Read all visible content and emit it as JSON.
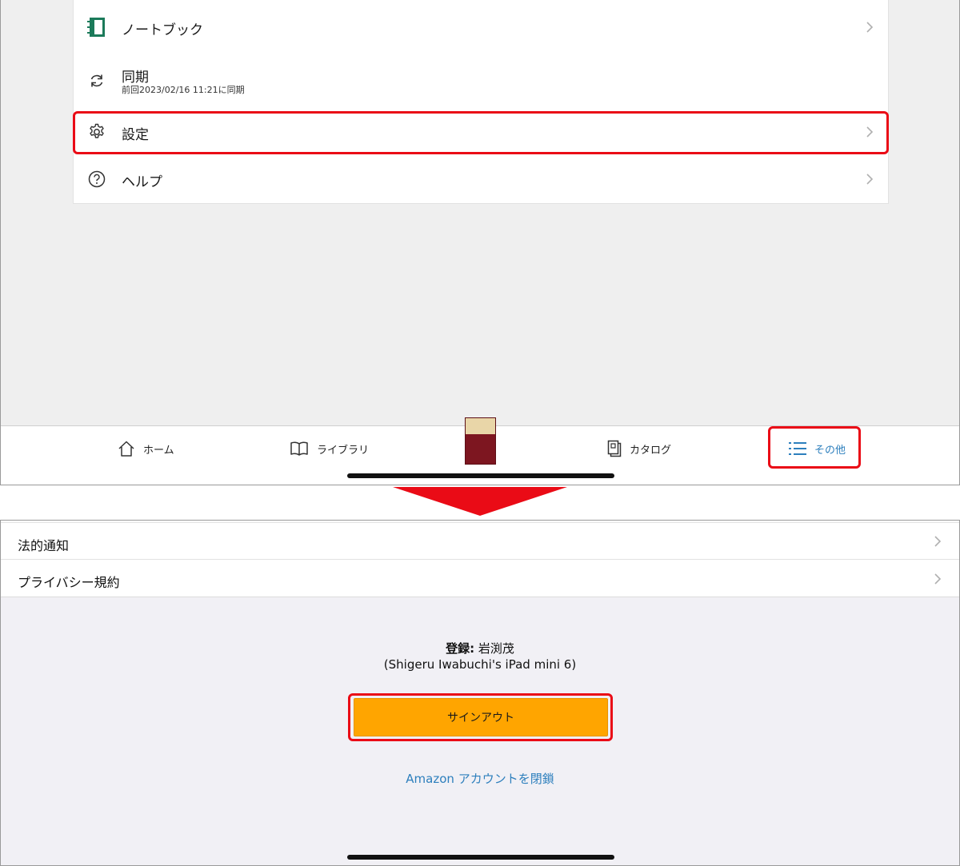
{
  "top_screen": {
    "menu": {
      "notebook": {
        "label": "ノートブック",
        "icon": "notebook-icon",
        "icon_color": "#1b7a5a"
      },
      "sync": {
        "label": "同期",
        "last_synced": "前回2023/02/16 11:21に同期",
        "icon": "sync-icon"
      },
      "settings": {
        "label": "設定",
        "icon": "gear-icon"
      },
      "help": {
        "label": "ヘルプ",
        "icon": "help-icon"
      }
    },
    "tabbar": {
      "home": "ホーム",
      "library": "ライブラリ",
      "catalog": "カタログ",
      "more": "その他",
      "active_color": "#2d7fbd"
    },
    "highlight_color": "#ea0b16"
  },
  "bottom_screen": {
    "legal_notice": "法的通知",
    "privacy_terms": "プライバシー規約",
    "registered_label": "登録:",
    "registered_name": " 岩渕茂",
    "device_name": "(Shigeru Iwabuchi's iPad mini 6)",
    "signout_label": "サインアウト",
    "close_account_link": "Amazon アカウントを閉鎖",
    "button_color": "#ffa500",
    "link_color": "#2d7fbd"
  },
  "arrow_color": "#ea0b16"
}
